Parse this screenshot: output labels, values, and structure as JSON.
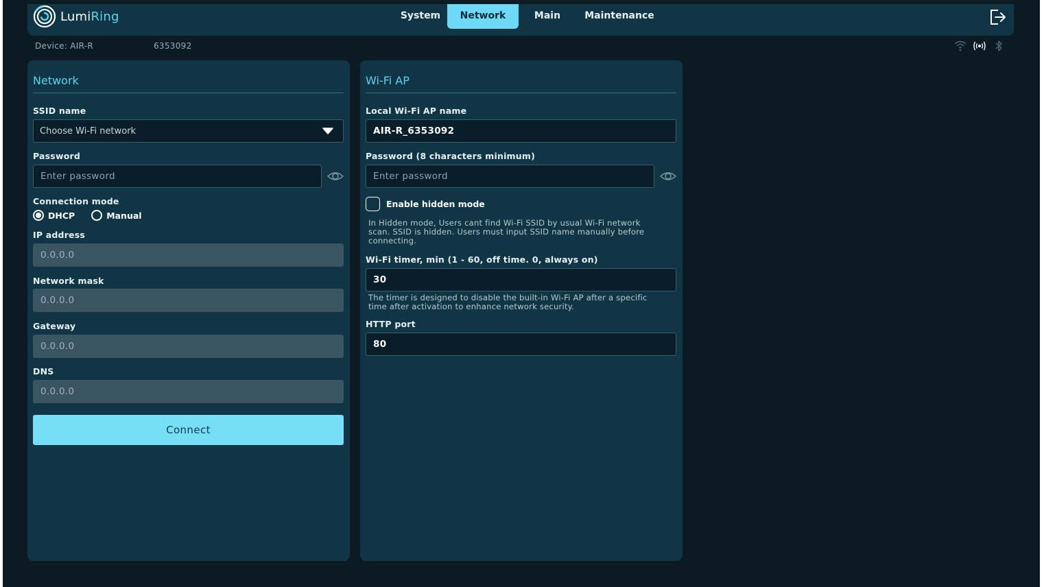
{
  "header": {
    "brand_prefix": "Lumi",
    "brand_suffix": "Ring",
    "tabs": [
      {
        "label": "System",
        "active": false
      },
      {
        "label": "Network",
        "active": true
      },
      {
        "label": "Main",
        "active": false
      },
      {
        "label": "Maintenance",
        "active": false
      }
    ],
    "logout_icon": "logout-icon"
  },
  "device": {
    "label": "Device: AIR-R",
    "serial": "6353092"
  },
  "status_icons": [
    "wifi-icon",
    "broadcast-icon",
    "bluetooth-icon"
  ],
  "network_panel": {
    "title": "Network",
    "ssid_label": "SSID name",
    "ssid_placeholder": "Choose Wi-Fi network",
    "password_label": "Password",
    "password_placeholder": "Enter password",
    "mode_label": "Connection mode",
    "modes": [
      {
        "label": "DHCP",
        "selected": true
      },
      {
        "label": "Manual",
        "selected": false
      }
    ],
    "ip_label": "IP address",
    "ip_value": "0.0.0.0",
    "mask_label": "Network mask",
    "mask_value": "0.0.0.0",
    "gateway_label": "Gateway",
    "gateway_value": "0.0.0.0",
    "dns_label": "DNS",
    "dns_value": "0.0.0.0",
    "connect_label": "Connect"
  },
  "wifi_panel": {
    "title": "Wi-Fi AP",
    "ap_name_label": "Local Wi-Fi AP name",
    "ap_name_value": "AIR-R_6353092",
    "password_label": "Password (8 characters minimum)",
    "password_placeholder": "Enter password",
    "hidden_label": "Enable hidden mode",
    "hidden_checked": false,
    "hidden_help_1": "In Hidden mode, Users cant find Wi-Fi SSID by usual Wi-Fi network",
    "hidden_help_2": "scan. SSID is hidden. Users must input SSID name manually before",
    "hidden_help_3": "connecting.",
    "timer_label": "Wi-Fi timer, min (1 - 60, off time. 0, always on)",
    "timer_value": "30",
    "timer_help_1": "The timer is designed to disable the built-in Wi-Fi AP after a specific",
    "timer_help_2": "time after activation to enhance network security.",
    "port_label": "HTTP port",
    "port_value": "80"
  },
  "colors": {
    "background": "#0c1a23",
    "panel": "#103645",
    "accent": "#5fd2f0",
    "button": "#77def8",
    "disabled_input": "#3b5461"
  }
}
